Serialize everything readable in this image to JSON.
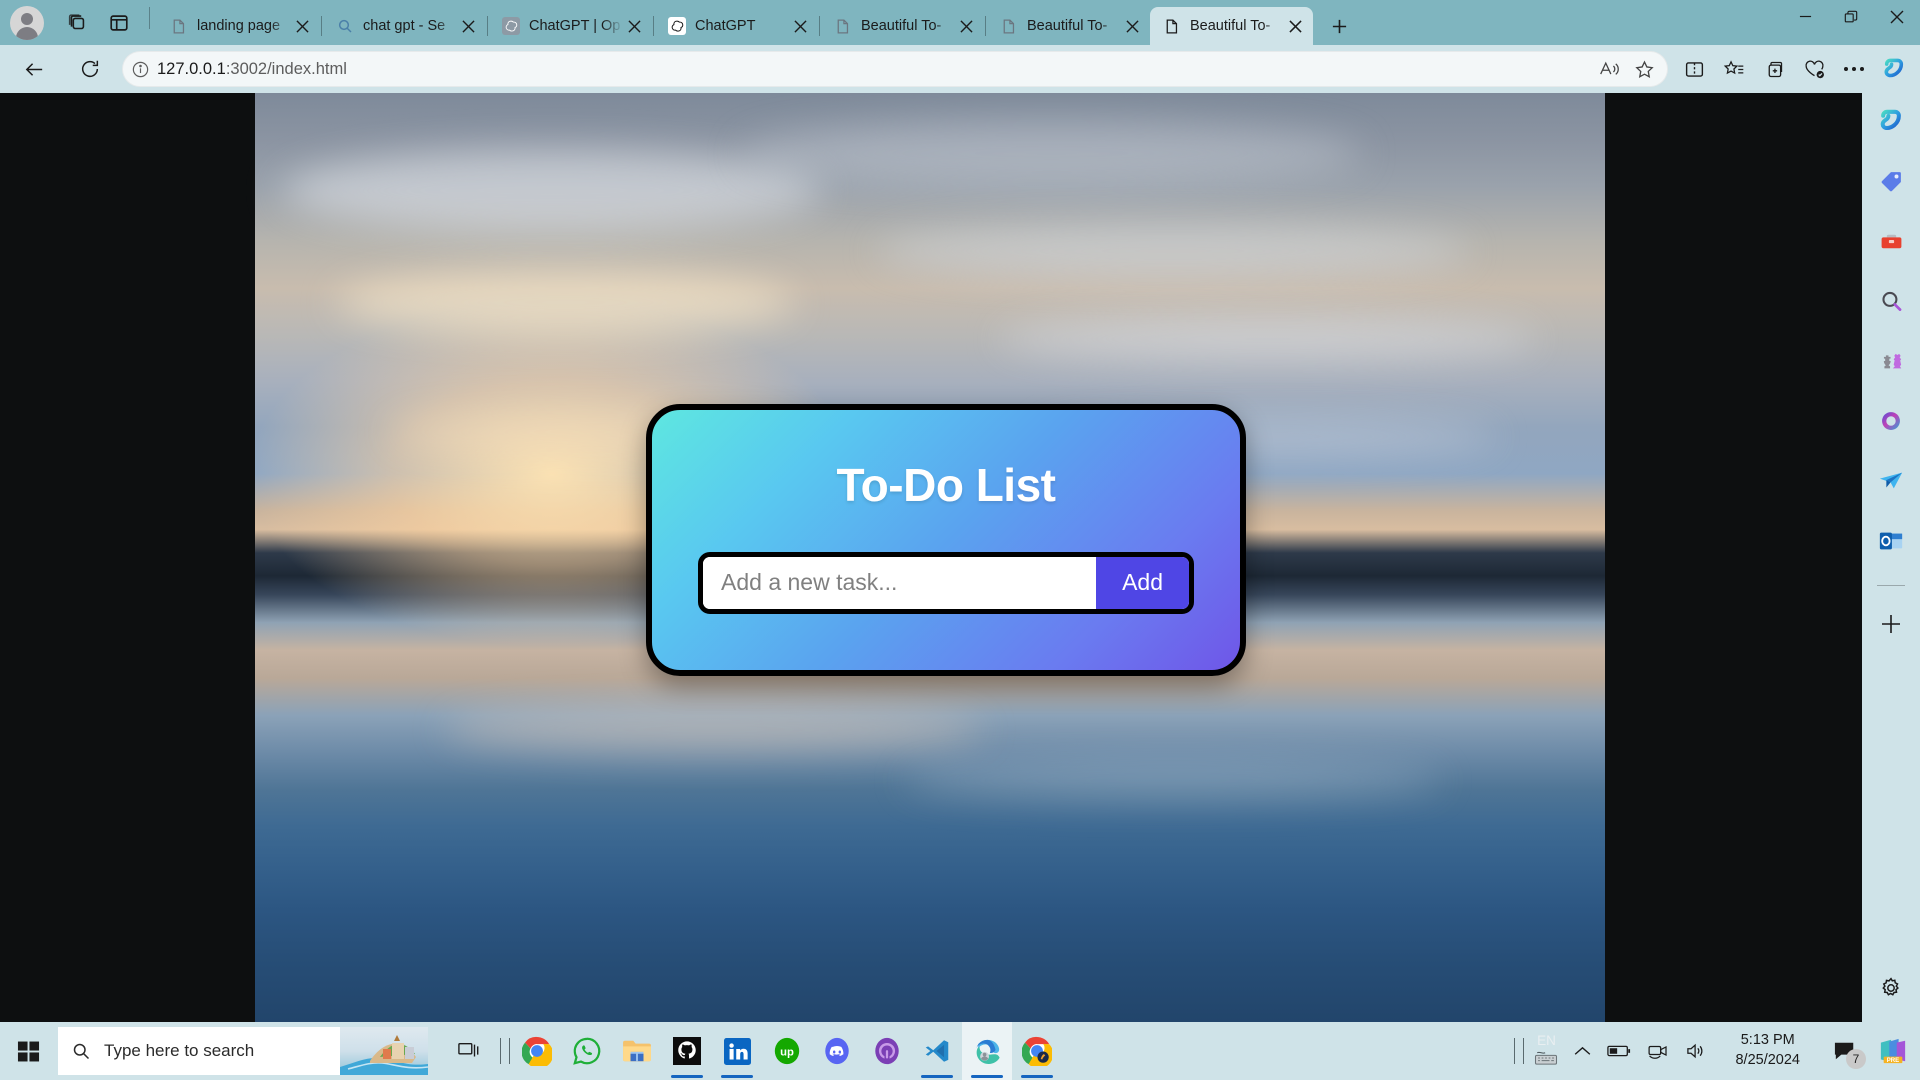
{
  "browser": {
    "profile_name": "profile-avatar",
    "tabs": [
      {
        "title": "landing page",
        "favicon": "document-icon",
        "active": false
      },
      {
        "title": "chat gpt - Se",
        "favicon": "search-icon",
        "active": false
      },
      {
        "title": "ChatGPT | Op",
        "favicon": "openai-icon",
        "active": false
      },
      {
        "title": "ChatGPT",
        "favicon": "openai-icon",
        "active": false
      },
      {
        "title": "Beautiful To-",
        "favicon": "document-icon",
        "active": false
      },
      {
        "title": "Beautiful To-",
        "favicon": "document-icon",
        "active": false
      },
      {
        "title": "Beautiful To-",
        "favicon": "document-icon",
        "active": true
      }
    ],
    "new_tab_label": "+",
    "window_controls": {
      "minimize": "minimize",
      "restore": "restore",
      "close": "close"
    },
    "address_bar": {
      "host": "127.0.0.1",
      "rest": ":3002/index.html",
      "full_url": "127.0.0.1:3002/index.html",
      "site_info_icon": "info-icon",
      "read_aloud_icon": "read-aloud-icon",
      "favorite_icon": "star-icon"
    },
    "nav": {
      "back": "back-arrow-icon",
      "refresh": "refresh-icon"
    },
    "toolbar_right": [
      {
        "name": "split-screen-icon"
      },
      {
        "name": "favorites-icon"
      },
      {
        "name": "collections-icon"
      },
      {
        "name": "browser-essentials-icon"
      },
      {
        "name": "settings-and-more-icon"
      },
      {
        "name": "copilot-icon"
      }
    ],
    "sidebar": [
      {
        "name": "copilot-icon"
      },
      {
        "name": "shopping-tag-icon"
      },
      {
        "name": "tools-icon"
      },
      {
        "name": "search-icon"
      },
      {
        "name": "games-icon"
      },
      {
        "name": "microsoft-365-icon"
      },
      {
        "name": "drop-icon"
      },
      {
        "name": "outlook-icon"
      },
      {
        "name": "add-sidebar-app-icon"
      },
      {
        "name": "sidebar-settings-icon"
      }
    ]
  },
  "page": {
    "title": "To-Do List",
    "input_placeholder": "Add a new task...",
    "input_value": "",
    "add_button_label": "Add",
    "background": "sunset-lake-photo",
    "accent_color": "#4f46e5",
    "card_gradient_from": "#5ee7e0",
    "card_gradient_to": "#6f56e8"
  },
  "taskbar": {
    "start_label": "start-button",
    "search_placeholder": "Type here to search",
    "task_view": "task-view-icon",
    "apps": [
      {
        "name": "chrome",
        "active": false
      },
      {
        "name": "whatsapp",
        "active": false
      },
      {
        "name": "file-explorer",
        "active": false
      },
      {
        "name": "github",
        "active": true
      },
      {
        "name": "linkedin",
        "active": true
      },
      {
        "name": "upwork",
        "active": false
      },
      {
        "name": "discord",
        "active": false
      },
      {
        "name": "gitkraken",
        "active": false
      },
      {
        "name": "vs-code",
        "active": true
      },
      {
        "name": "microsoft-edge",
        "active": true
      },
      {
        "name": "chrome-second",
        "active": true
      }
    ],
    "tray": {
      "language": "EN",
      "keyboard_icon": "keyboard-icon",
      "show_hidden_icon": "chevron-up-icon",
      "battery_icon": "battery-icon",
      "camera_icon": "camera-icon",
      "volume_icon": "volume-icon",
      "time": "5:13 PM",
      "date": "8/25/2024",
      "notification_count": "7",
      "powerpoint_icon": "powerpoint-pre-icon"
    }
  }
}
